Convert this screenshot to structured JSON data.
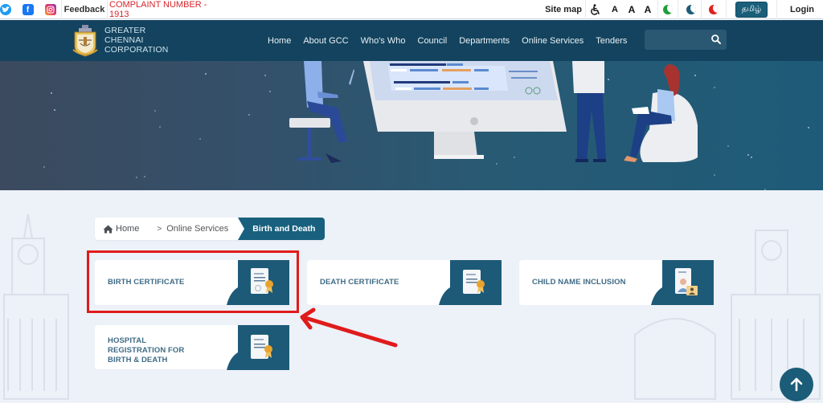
{
  "topbar": {
    "social": [
      "twitter-icon",
      "facebook-icon",
      "instagram-icon"
    ],
    "feedback": "Feedback",
    "complaint": "COMPLAINT NUMBER - 1913",
    "sitemap": "Site map",
    "accessibility_icon": "wheelchair-icon",
    "font_sizes": [
      "A",
      "A",
      "A"
    ],
    "themes": [
      {
        "name": "green",
        "color": "#1e9e3a"
      },
      {
        "name": "blue",
        "color": "#1b5c78"
      },
      {
        "name": "red",
        "color": "#e0201f"
      }
    ],
    "language": "தமிழ்",
    "login": "Login"
  },
  "header": {
    "logo_lines": [
      "GREATER",
      "CHENNAI",
      "CORPORATION"
    ],
    "nav": [
      "Home",
      "About GCC",
      "Who's Who",
      "Council",
      "Departments",
      "Online Services",
      "Tenders"
    ],
    "search_placeholder": ""
  },
  "breadcrumb": {
    "home": "Home",
    "separator": ">",
    "online_services": "Online Services",
    "current": "Birth and Death"
  },
  "cards": [
    {
      "label": "BIRTH CERTIFICATE",
      "icon": "certificate-icon",
      "highlighted": true
    },
    {
      "label": "DEATH CERTIFICATE",
      "icon": "certificate-icon",
      "highlighted": false
    },
    {
      "label": "CHILD NAME INCLUSION",
      "icon": "id-card-icon",
      "highlighted": false
    },
    {
      "label": "HOSPITAL REGISTRATION FOR BIRTH & DEATH",
      "icon": "certificate-icon",
      "highlighted": false
    }
  ],
  "colors": {
    "brand": "#13435e",
    "accent": "#18607e",
    "complaint": "#d7262c",
    "highlight": "#e01b1b",
    "page_bg": "#edf1f8"
  },
  "scroll_top_icon": "arrow-up-icon"
}
